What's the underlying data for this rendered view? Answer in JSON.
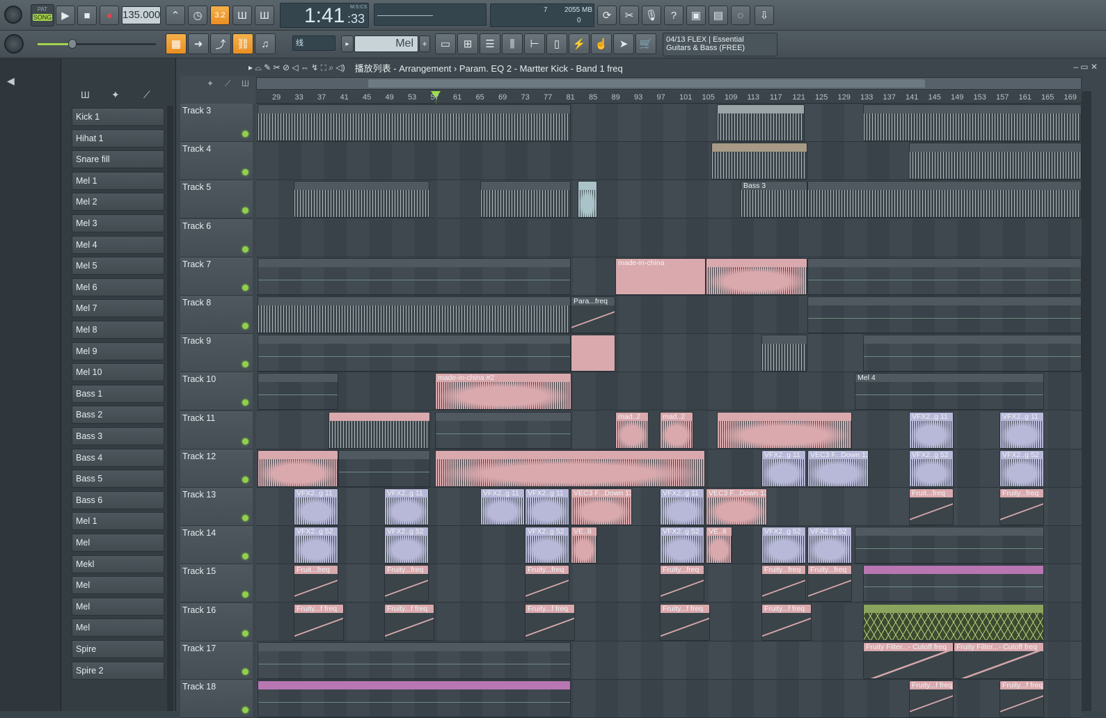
{
  "topbar": {
    "pat_label": "PAT",
    "song_label": "SONG",
    "tempo": "135.000",
    "time_main": "1:41",
    "time_small": ":33",
    "time_unit": "M:S:CS",
    "cpu_value": "7",
    "mem_value": "2055 MB",
    "voices": "0",
    "snap_label": "线",
    "pattern_label": "Mel",
    "news_line1": "04/13  FLEX | Essential",
    "news_line2": "Guitars & Bass (FREE)"
  },
  "breadcrumb": {
    "text": "播放列表 - Arrangement  ›  Param. EQ 2 - Martter Kick  - Band 1 freq"
  },
  "channels": [
    "Kick 1",
    "Hihat 1",
    "Snare fill",
    "Mel 1",
    "Mel 2",
    "Mel 3",
    "Mel 4",
    "Mel 5",
    "Mel 6",
    "Mel 7",
    "Mel 8",
    "Mel 9",
    "Mel 10",
    "Bass 1",
    "Bass 2",
    "Bass 3",
    "Bass 4",
    "Bass 5",
    "Bass 6",
    "Mel 1",
    "Mel",
    "Mekl",
    "Mel",
    "Mel",
    "Mel",
    "Spire",
    "Spire 2"
  ],
  "ruler": [
    "29",
    "33",
    "37",
    "41",
    "45",
    "49",
    "53",
    "57",
    "61",
    "65",
    "69",
    "73",
    "77",
    "81",
    "85",
    "89",
    "93",
    "97",
    "101",
    "105",
    "109",
    "113",
    "117",
    "121",
    "125",
    "129",
    "133",
    "137",
    "141",
    "145",
    "149",
    "153",
    "157",
    "161",
    "165",
    "169"
  ],
  "tracks": [
    "Track 3",
    "Track 4",
    "Track 5",
    "Track 6",
    "Track 7",
    "Track 8",
    "Track 9",
    "Track 10",
    "Track 11",
    "Track 12",
    "Track 13",
    "Track 14",
    "Track 15",
    "Track 16",
    "Track 17",
    "Track 18"
  ],
  "clip_labels": {
    "made_in_china": "made-in-china",
    "made_in_china_2": "made-in-china #2",
    "bass3": "Bass 3",
    "para_freq": "Para...freq",
    "mad2": "mad..2",
    "vfx11": "VFX2..g 11",
    "vfx52": "VFX2..g 52",
    "vec3": "VEC3 F...Down 13",
    "ve8": "VE..8",
    "fruity_freq": "Fruity...freq",
    "fruit_freq": "Fruit...freq",
    "fruity_f_freq": "Fruity...f freq",
    "cutoff": "Fruity Filter...- Cutoff freq",
    "mel4": "Mel 4"
  },
  "colors": {
    "accent": "#f0a53a",
    "clip_pink": "#d9a9ad",
    "clip_gray": "#5a646a",
    "clip_purple": "#b877b3",
    "clip_green": "#8aa35d",
    "clip_lavender": "#b8b8d8",
    "clip_teal": "#a9c3c8",
    "active_dot": "#8fd14a"
  }
}
